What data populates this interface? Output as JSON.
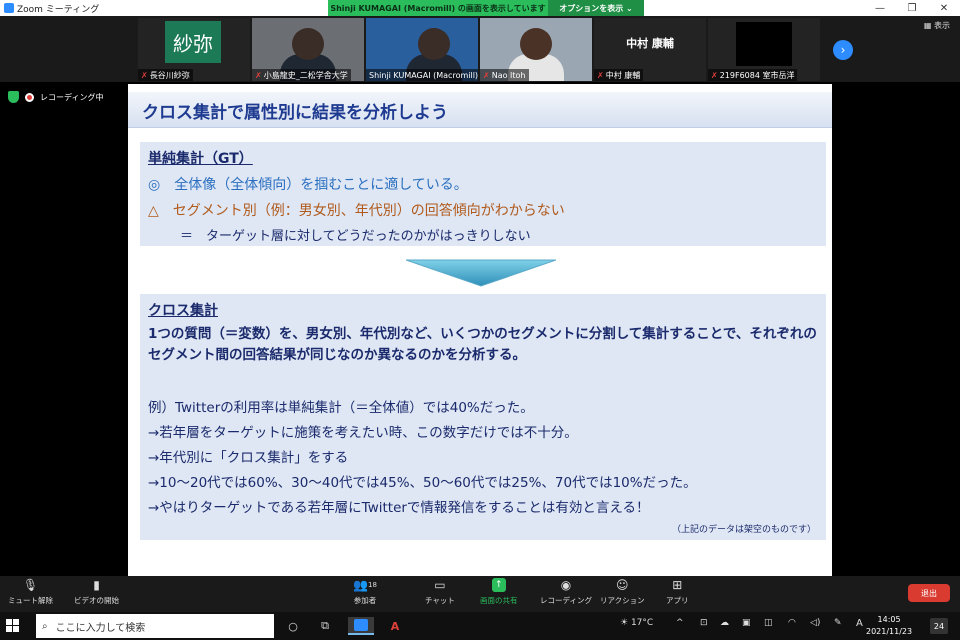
{
  "window": {
    "title": "Zoom ミーティング",
    "controls": [
      "—",
      "❐",
      "✕"
    ]
  },
  "share_banner": {
    "presenter_text": "Shinji KUMAGAI (Macromill) の画面を表示しています",
    "options_label": "オプションを表示 ⌄"
  },
  "gallery": {
    "view_label": "▦ 表示",
    "tiles": [
      {
        "name": "長谷川紗弥",
        "avatar_text": "紗弥"
      },
      {
        "name": "小島龍史_二松学舎大学"
      },
      {
        "name": "Shinji KUMAGAI (Macromill)"
      },
      {
        "name": "Nao Itoh"
      },
      {
        "name": "中村 康輔",
        "display_text": "中村 康輔"
      },
      {
        "name": "219F6084 室市岳洋"
      }
    ]
  },
  "recording_label": "レコーディング中",
  "slide": {
    "title": "クロス集計で属性別に結果を分析しよう",
    "gt": {
      "heading": "単純集計（GT）",
      "line1": "◎　全体像（全体傾向）を掴むことに適している。",
      "line2": "△　セグメント別（例：男女別、年代別）の回答傾向がわからない",
      "line3": "＝　ターゲット層に対してどうだったのかがはっきりしない"
    },
    "cross": {
      "heading": "クロス集計",
      "desc": "1つの質問（＝変数）を、男女別、年代別など、いくつかのセグメントに分割して集計することで、それぞれのセグメント間の回答結果が同じなのか異なるのかを分析する。",
      "examples": [
        "例）Twitterの利用率は単純集計（＝全体値）では40%だった。",
        "→若年層をターゲットに施策を考えたい時、この数字だけでは不十分。",
        "→年代別に「クロス集計」をする",
        "→10～20代では60%、30～40代では45%、50～60代では25%、70代では10%だった。",
        "→やはりターゲットである若年層にTwitterで情報発信をすることは有効と言える！"
      ],
      "note": "（上記のデータは架空のものです）"
    }
  },
  "controls": {
    "mute": "ミュート解除",
    "video": "ビデオの開始",
    "participants": "参加者",
    "participants_count": "18",
    "chat": "チャット",
    "share": "画面の共有",
    "record": "レコーディング",
    "reactions": "リアクション",
    "apps": "アプリ",
    "end": "退出"
  },
  "taskbar": {
    "search_placeholder": "ここに入力して検索",
    "weather": "17°C",
    "ime": "A",
    "time": "14:05",
    "date": "2021/11/23",
    "notifications": "24"
  }
}
